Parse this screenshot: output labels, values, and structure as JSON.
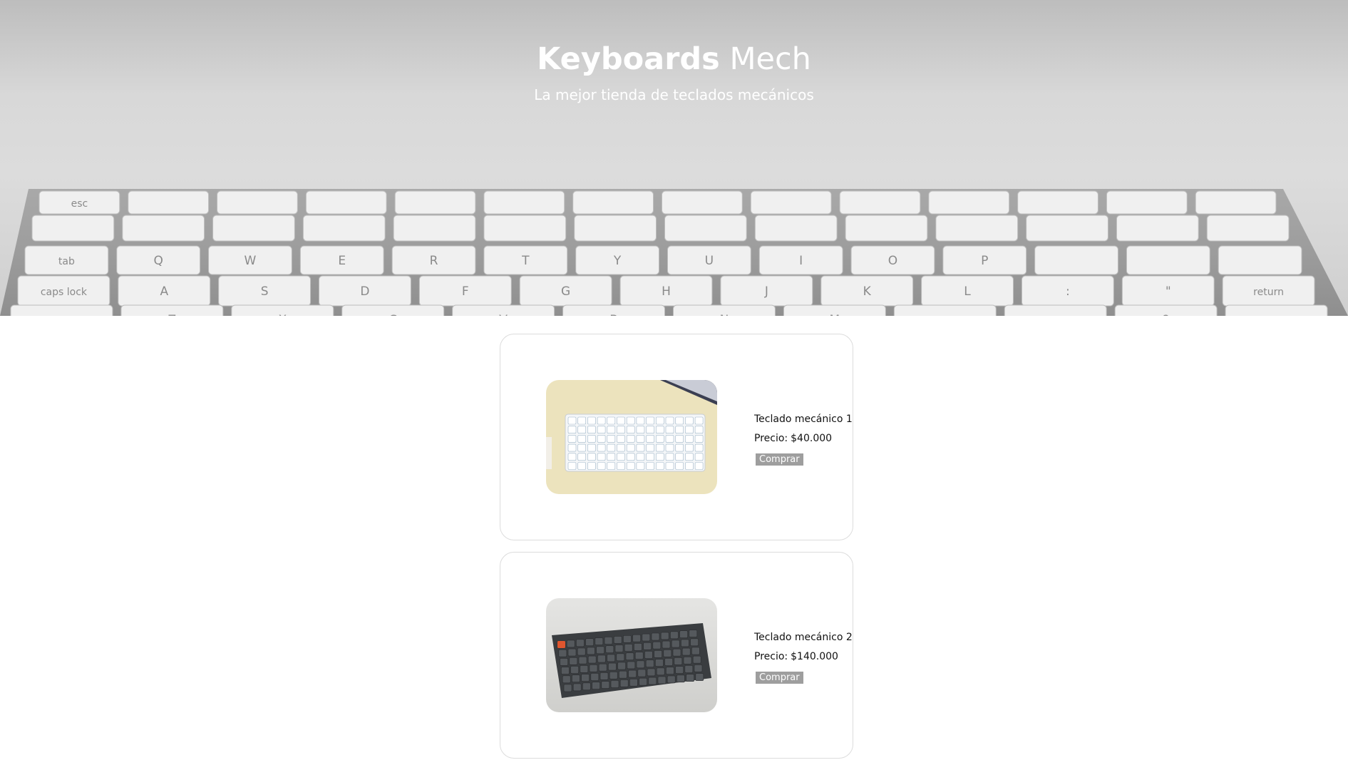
{
  "hero": {
    "title_strong": "Keyboards",
    "title_light": "Mech",
    "subtitle": "La mejor tienda de teclados mecánicos",
    "keyboard_rows": [
      [
        "esc",
        "",
        "",
        "",
        "",
        "",
        "",
        "",
        "",
        "",
        "",
        "",
        "",
        ""
      ],
      [
        "",
        "",
        "",
        "",
        "",
        "",
        "",
        "",
        "",
        "",
        "",
        "",
        "",
        ""
      ],
      [
        "tab",
        "Q",
        "W",
        "E",
        "R",
        "T",
        "Y",
        "U",
        "I",
        "O",
        "P",
        "",
        "",
        ""
      ],
      [
        "caps lock",
        "A",
        "S",
        "D",
        "F",
        "G",
        "H",
        "J",
        "K",
        "L",
        ":",
        "\"",
        "return"
      ],
      [
        "",
        "Z",
        "X",
        "C",
        "V",
        "B",
        "N",
        "M",
        "<",
        ">",
        "?",
        ""
      ]
    ]
  },
  "products": [
    {
      "name": "Teclado mecánico 1",
      "price_label": "Precio:",
      "price": "$40.000",
      "buy_label": "Comprar",
      "image": "white-keyboard-on-yellow-desk"
    },
    {
      "name": "Teclado mecánico 2",
      "price_label": "Precio:",
      "price": "$140.000",
      "buy_label": "Comprar",
      "image": "dark-grey-keyboard"
    }
  ],
  "colors": {
    "hero_text": "#ffffff",
    "button_bg": "#9e9e9e",
    "card_border": "#dcdcdc"
  }
}
